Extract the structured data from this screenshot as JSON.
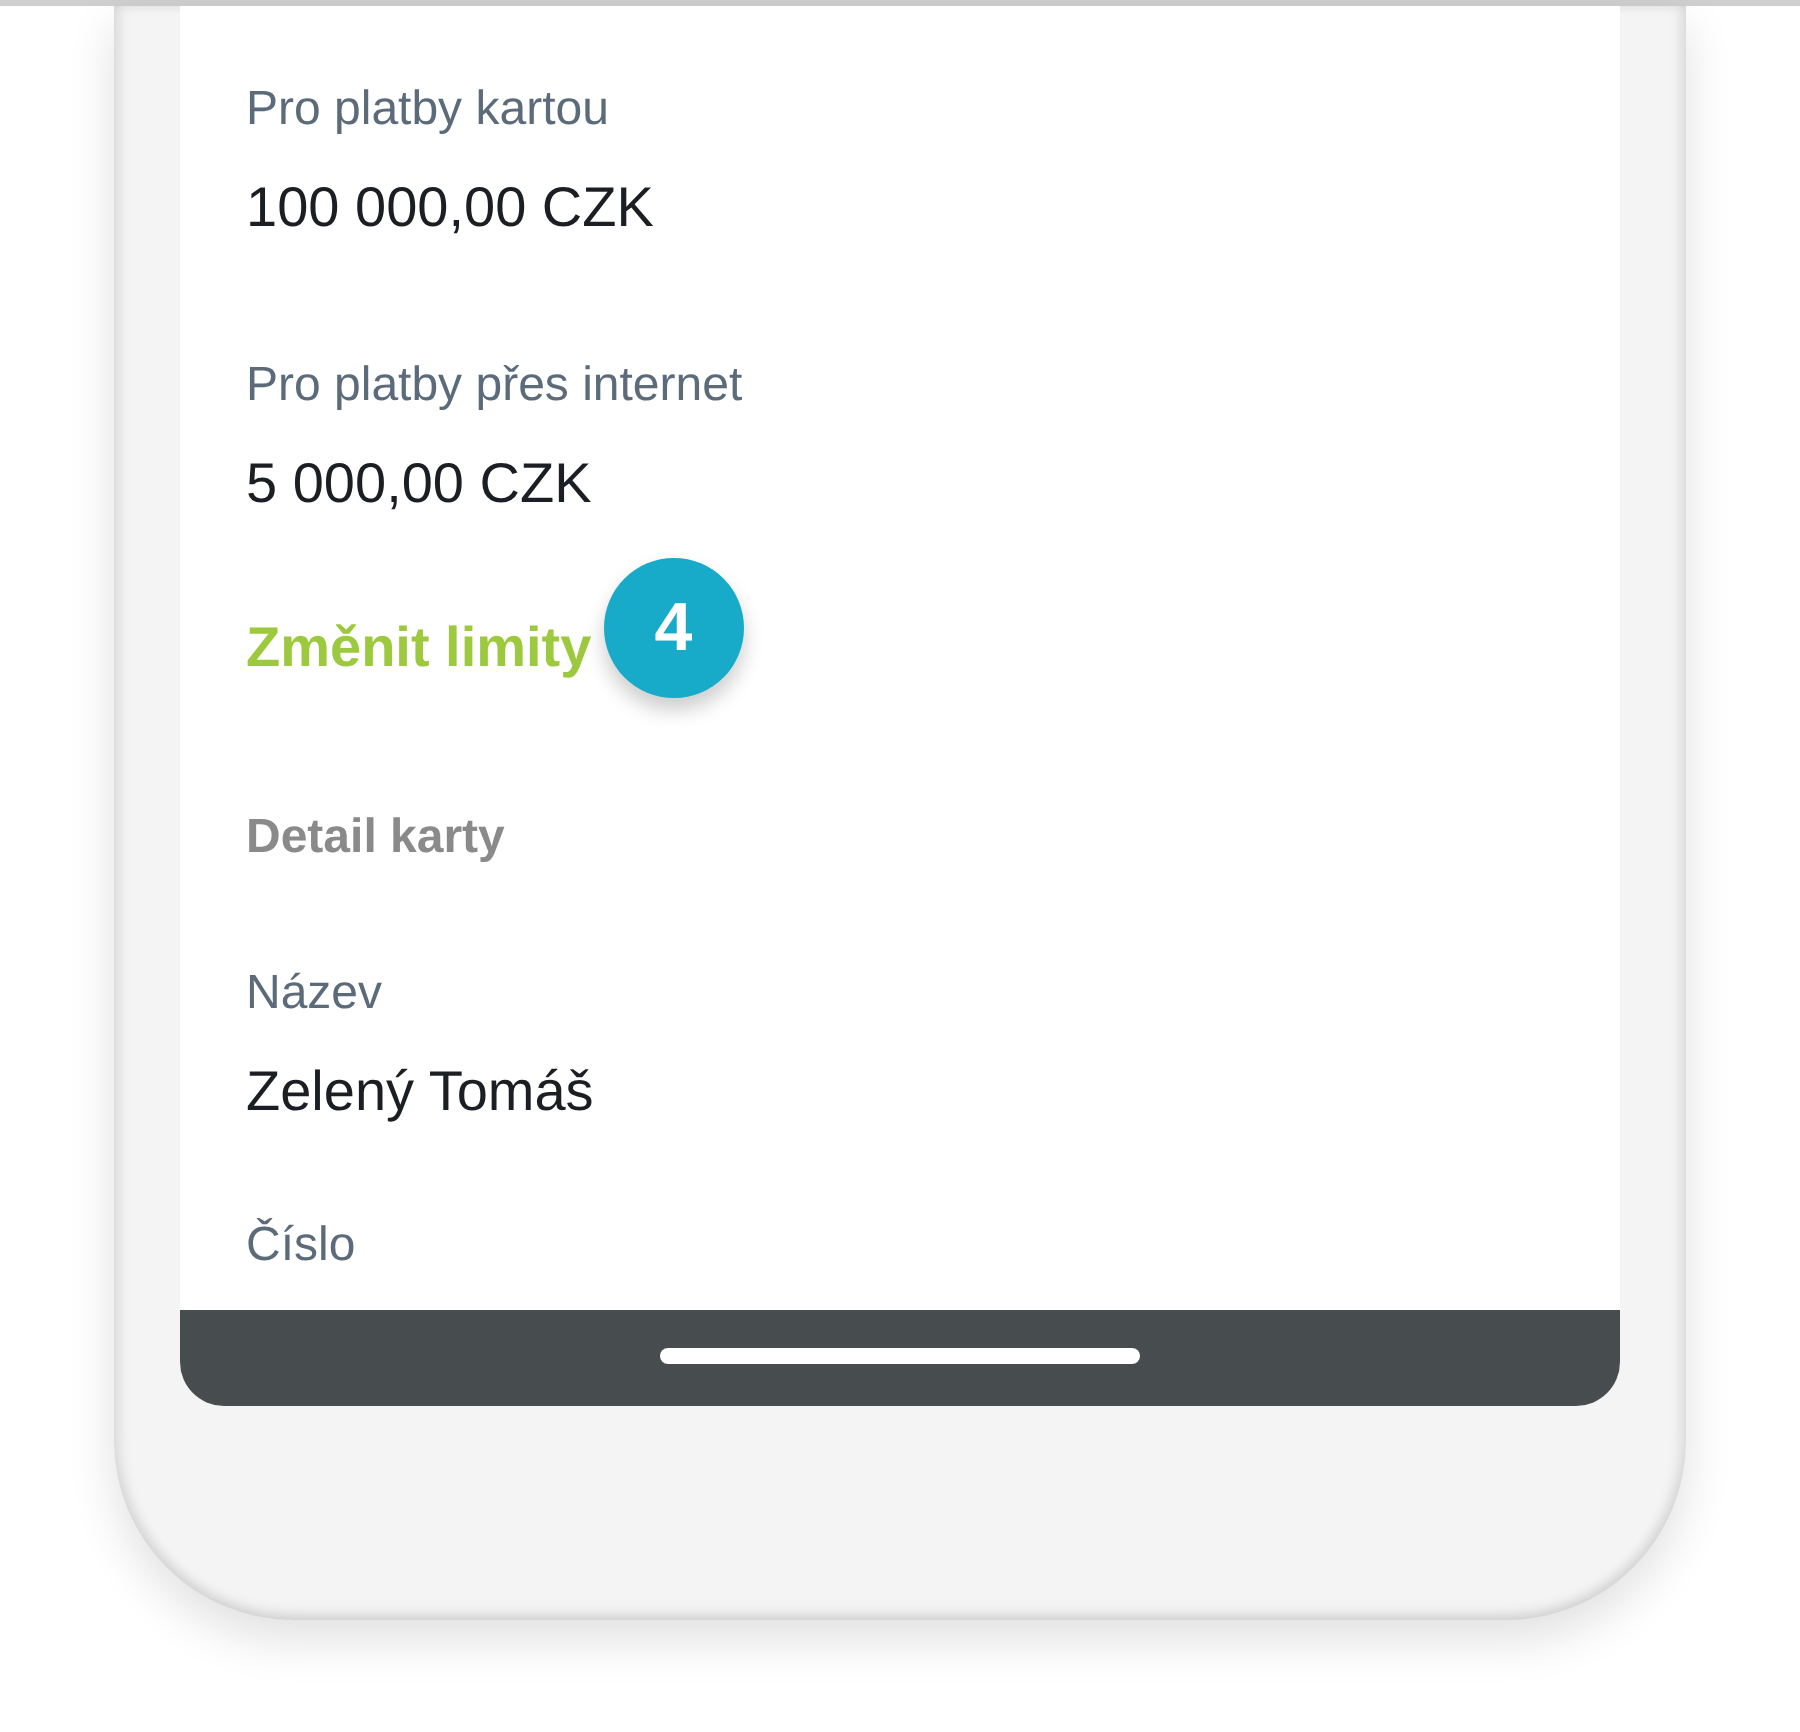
{
  "items": [
    {
      "kind": "field",
      "label": "Pro platby kartou",
      "value": "100 000,00 CZK"
    },
    {
      "kind": "field",
      "label": "Pro platby přes internet",
      "value": "5 000,00 CZK"
    },
    {
      "kind": "link",
      "text": "Změnit limity",
      "badge": "4"
    },
    {
      "kind": "heading",
      "text": "Detail karty"
    },
    {
      "kind": "field",
      "label": "Název",
      "value": "Zelený Tomáš"
    },
    {
      "kind": "field",
      "label": "Číslo"
    }
  ]
}
